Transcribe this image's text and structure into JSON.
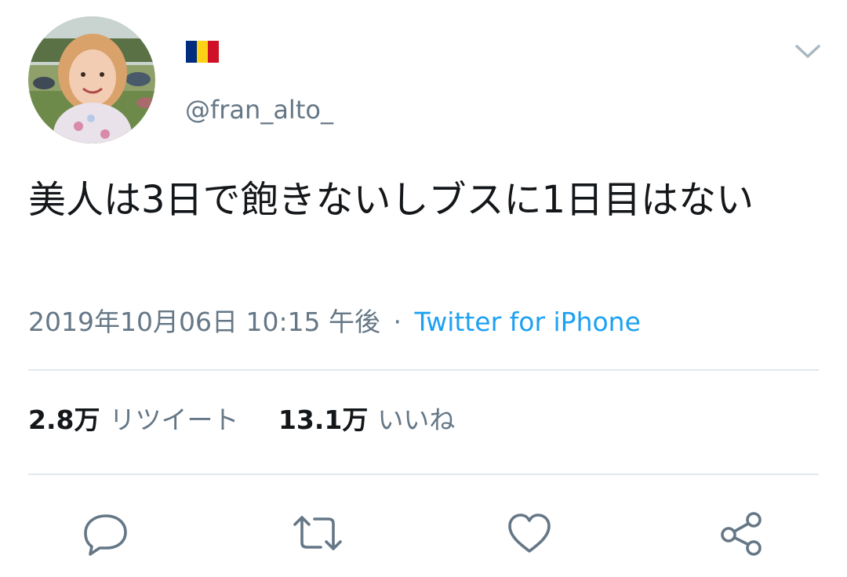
{
  "author": {
    "avatar_icon": "profile-photo",
    "flag_colors": [
      "#002b7f",
      "#fcd116",
      "#ce1126"
    ],
    "handle": "@fran_alto_"
  },
  "menu": {
    "icon": "chevron-down-icon"
  },
  "tweet": {
    "text": "美人は3日で飽きないしブスに1日目はない"
  },
  "meta": {
    "timestamp": "2019年10月06日 10:15 午後",
    "separator": "·",
    "source": "Twitter for iPhone"
  },
  "stats": {
    "retweets_count": "2.8万",
    "retweets_label": "リツイート",
    "likes_count": "13.1万",
    "likes_label": "いいね"
  },
  "actions": {
    "reply_icon": "reply-icon",
    "retweet_icon": "retweet-icon",
    "like_icon": "heart-icon",
    "share_icon": "share-icon"
  },
  "colors": {
    "text": "#14171a",
    "secondary": "#657786",
    "link": "#1da1f2",
    "divider": "#e1e8ed"
  }
}
